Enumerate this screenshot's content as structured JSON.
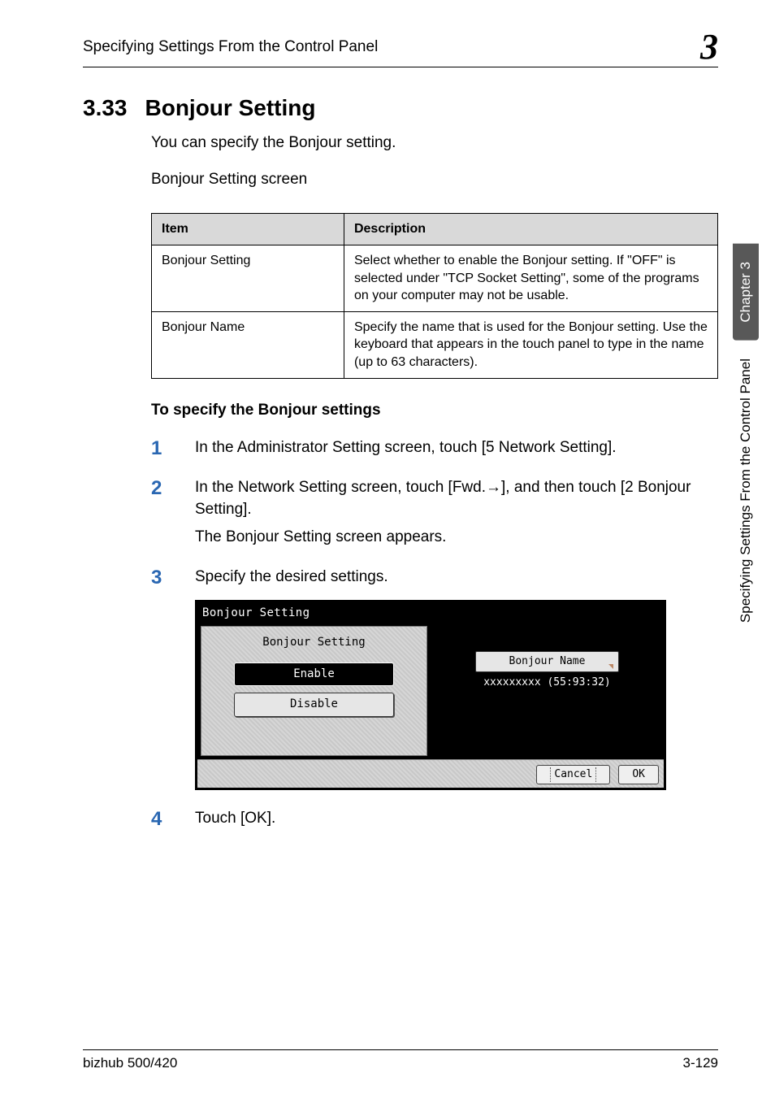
{
  "running_head": "Specifying Settings From the Control Panel",
  "chapter_badge": "3",
  "section": {
    "number": "3.33",
    "title": "Bonjour Setting"
  },
  "intro": [
    "You can specify the Bonjour setting.",
    "Bonjour Setting screen"
  ],
  "table": {
    "headers": [
      "Item",
      "Description"
    ],
    "rows": [
      {
        "item": "Bonjour Setting",
        "desc": "Select whether to enable the Bonjour setting. If \"OFF\" is selected under \"TCP Socket Setting\", some of the programs on your computer may not be usable."
      },
      {
        "item": "Bonjour Name",
        "desc": "Specify the name that is used for the Bonjour setting. Use the keyboard that appears in the touch panel to type in the name (up to 63 characters)."
      }
    ]
  },
  "subheading": "To specify the Bonjour settings",
  "steps": [
    {
      "n": "1",
      "text": "In the Administrator Setting screen, touch [5 Network Setting]."
    },
    {
      "n": "2",
      "text": "In the Network Setting screen, touch [Fwd.→], and then touch [2 Bonjour Setting].",
      "follow": "The Bonjour Setting screen appears."
    },
    {
      "n": "3",
      "text": "Specify the desired settings."
    },
    {
      "n": "4",
      "text": "Touch [OK]."
    }
  ],
  "panel": {
    "title": "Bonjour Setting",
    "left_group": "Bonjour Setting",
    "enable": "Enable",
    "disable": "Disable",
    "right_label": "Bonjour Name",
    "right_value": "xxxxxxxxx (55:93:32)",
    "cancel": "Cancel",
    "ok": "OK"
  },
  "side_tab": {
    "dark": "Chapter 3",
    "light": "Specifying Settings From the Control Panel"
  },
  "footer": {
    "left": "bizhub 500/420",
    "right": "3-129"
  }
}
